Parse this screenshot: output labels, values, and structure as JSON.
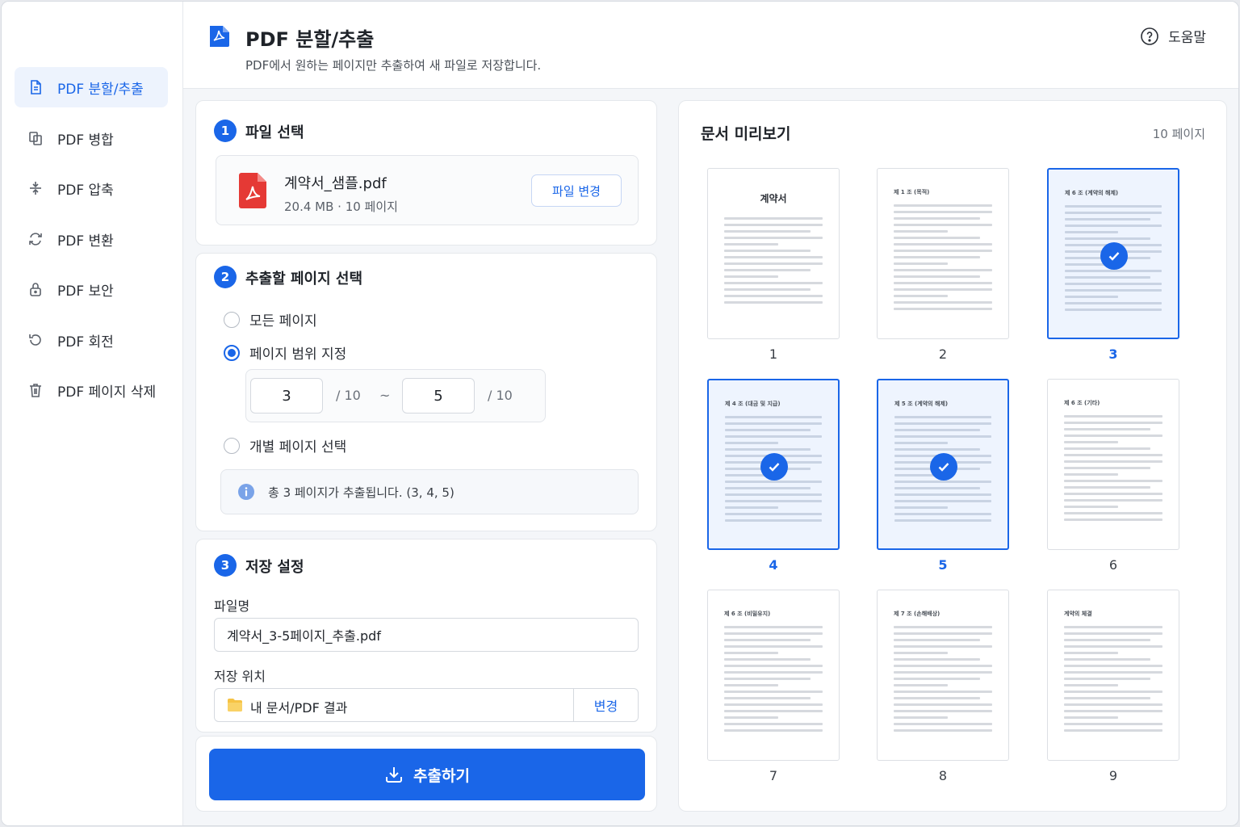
{
  "sidebar": {
    "items": [
      {
        "label": "PDF 분할/추출",
        "icon": "file-split-icon",
        "active": true
      },
      {
        "label": "PDF 병합",
        "icon": "merge-icon",
        "active": false
      },
      {
        "label": "PDF 압축",
        "icon": "compress-icon",
        "active": false
      },
      {
        "label": "PDF 변환",
        "icon": "convert-icon",
        "active": false
      },
      {
        "label": "PDF 보안",
        "icon": "lock-icon",
        "active": false
      },
      {
        "label": "PDF 회전",
        "icon": "rotate-icon",
        "active": false
      },
      {
        "label": "PDF 페이지 삭제",
        "icon": "trash-icon",
        "active": false
      }
    ]
  },
  "header": {
    "title": "PDF 분할/추출",
    "subtitle": "PDF에서 원하는 페이지만 추출하여 새 파일로 저장합니다.",
    "help_label": "도움말"
  },
  "step1": {
    "num": "1",
    "title": "파일 선택",
    "file_name": "계약서_샘플.pdf",
    "file_meta": "20.4 MB  ·  10 페이지",
    "change_button": "파일 변경"
  },
  "step2": {
    "num": "2",
    "title": "추출할 페이지 선택",
    "options": {
      "all": "모든 페이지",
      "range": "페이지 범위 지정",
      "individual": "개별 페이지 선택"
    },
    "selected_option": "range",
    "range_from": "3",
    "range_to": "5",
    "total_label": "/ 10",
    "tilde": "~",
    "info": "총 3 페이지가 추출됩니다.  (3, 4, 5)"
  },
  "step3": {
    "num": "3",
    "title": "저장 설정",
    "filename_label": "파일명",
    "filename_value": "계약서_3-5페이지_추출.pdf",
    "location_label": "저장 위치",
    "location_value": "내 문서/PDF 결과",
    "location_change": "변경"
  },
  "extract_button": "추출하기",
  "preview": {
    "title": "문서 미리보기",
    "count": "10 페이지",
    "pages": [
      {
        "num": "1",
        "selected": false,
        "title": "계약서",
        "heading": ""
      },
      {
        "num": "2",
        "selected": false,
        "title": "",
        "heading": "제 1 조 (목적)"
      },
      {
        "num": "3",
        "selected": true,
        "title": "",
        "heading": "제 6 조 (계약의 해제)"
      },
      {
        "num": "4",
        "selected": true,
        "title": "",
        "heading": "제 4 조 (대금 및 지급)"
      },
      {
        "num": "5",
        "selected": true,
        "title": "",
        "heading": "제 5 조 (계약의 해제)"
      },
      {
        "num": "6",
        "selected": false,
        "title": "",
        "heading": "제 6 조 (기타)"
      },
      {
        "num": "7",
        "selected": false,
        "title": "",
        "heading": "제 6 조 (비밀유지)"
      },
      {
        "num": "8",
        "selected": false,
        "title": "",
        "heading": "제 7 조 (손해배상)"
      },
      {
        "num": "9",
        "selected": false,
        "title": "",
        "heading": "계약의 체결"
      }
    ]
  },
  "colors": {
    "accent": "#1a66e8",
    "pdf_red": "#e53935",
    "folder": "#f6c344"
  }
}
